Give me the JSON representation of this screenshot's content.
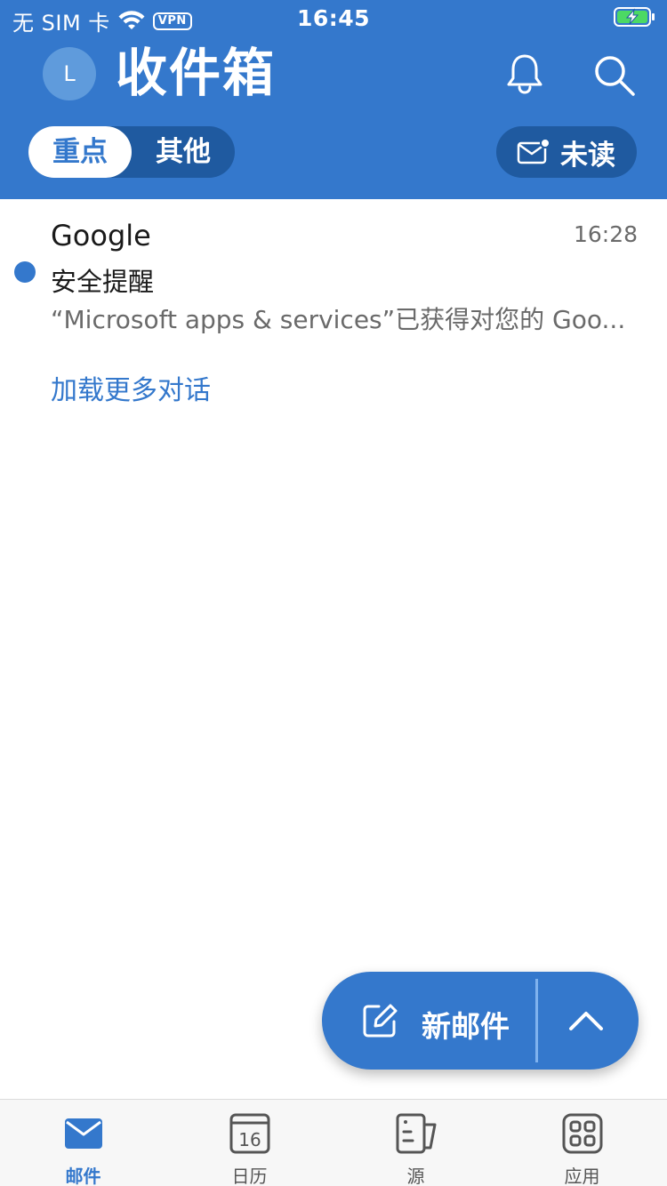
{
  "status_bar": {
    "carrier": "无 SIM 卡",
    "vpn": "VPN",
    "time": "16:45"
  },
  "header": {
    "avatar_initial": "L",
    "title": "收件箱",
    "tabs": [
      {
        "label": "重点",
        "active": true
      },
      {
        "label": "其他",
        "active": false
      }
    ],
    "unread_filter_label": "未读"
  },
  "messages": [
    {
      "sender": "Google",
      "time": "16:28",
      "subject": "安全提醒",
      "preview": "“Microsoft apps & services”已获得对您的 Goo...",
      "unread": true
    }
  ],
  "load_more_label": "加载更多对话",
  "compose": {
    "label": "新邮件"
  },
  "tab_bar": {
    "items": [
      {
        "label": "邮件",
        "icon": "mail-icon",
        "active": true
      },
      {
        "label": "日历",
        "icon": "calendar-icon",
        "active": false,
        "calendar_day": "16"
      },
      {
        "label": "源",
        "icon": "feed-icon",
        "active": false
      },
      {
        "label": "应用",
        "icon": "apps-icon",
        "active": false
      }
    ]
  },
  "colors": {
    "accent": "#3478cc",
    "accent_dark": "#1f5aa0",
    "tabbar_bg": "#f7f7f7"
  }
}
